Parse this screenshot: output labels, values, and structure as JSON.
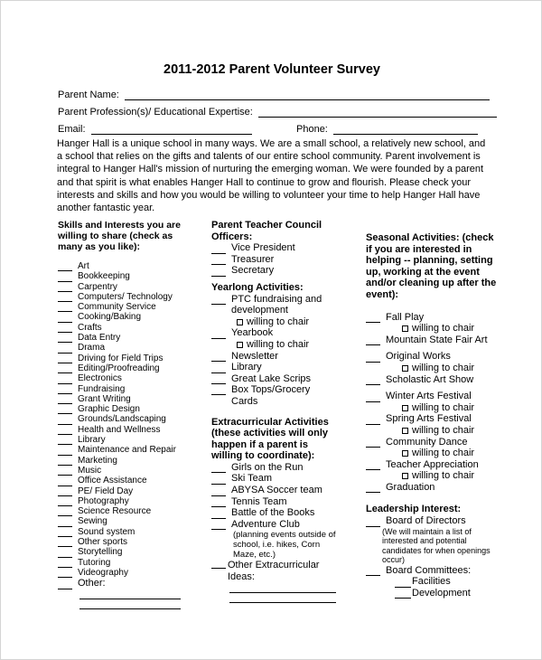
{
  "title": "2011-2012 Parent Volunteer Survey",
  "fields": {
    "parent_name": "Parent Name:",
    "profession": "Parent Profession(s)/ Educational Expertise:",
    "email": "Email:",
    "phone": "Phone:"
  },
  "intro": "Hanger Hall is a unique school in many ways. We are a small school, a relatively new school, and a school  that relies on the gifts and talents of our entire school community.  Parent involvement is integral to Hanger Hall's mission of nurturing the emerging woman.  We were founded by a parent and that spirit is what enables Hanger Hall to continue to grow and flourish.  Please check your interests and skills and how you would be willing to volunteer your time to help Hanger Hall have another fantastic year.",
  "chair_label": "willing to chair",
  "skills": {
    "header": "Skills and Interests you are willing to share (check as many as you like):",
    "items": [
      "Art",
      "Bookkeeping",
      "Carpentry",
      "Computers/ Technology",
      "Community Service",
      "Cooking/Baking",
      "Crafts",
      "Data Entry",
      "Drama",
      "Driving for Field Trips",
      "Editing/Proofreading",
      "Electronics",
      "Fundraising",
      "Grant Writing",
      "Graphic Design",
      "Grounds/Landscaping",
      "Health and Wellness",
      "Library",
      "Maintenance and Repair",
      "Marketing",
      "Music",
      "Office Assistance",
      "PE/ Field Day",
      "Photography",
      "Science Resource",
      "Sewing",
      "Sound system",
      "Other sports",
      "Storytelling",
      "Tutoring",
      "Videography"
    ],
    "other": "Other:"
  },
  "ptc": {
    "header": "Parent Teacher Council Officers:",
    "items": [
      "Vice President",
      "Treasurer",
      "Secretary"
    ]
  },
  "yearlong": {
    "header": "Yearlong Activities:",
    "items": [
      "PTC fundraising and development",
      "Yearbook",
      "Newsletter",
      "Library",
      "Great Lake Scrips",
      "Box Tops/Grocery Cards"
    ]
  },
  "extracurricular": {
    "header": "Extracurricular Activities (these activities will only happen if a parent is willing to coordinate):",
    "items": [
      "Girls on the Run",
      "Ski Team",
      "ABYSA Soccer team",
      "Tennis Team",
      "Battle of the Books",
      "Adventure Club"
    ],
    "adventure_note": "(planning events outside of school, i.e. hikes, Corn Maze, etc.)",
    "other": "Other Extracurricular Ideas:"
  },
  "seasonal": {
    "header": "Seasonal Activities: (check if you are interested in helping -- planning, setting up, working at the event and/or cleaning up after the event):",
    "items": [
      "Fall Play",
      "Mountain State Fair Art",
      "Original Works",
      "Scholastic Art Show",
      "Winter Arts Festival",
      "Spring Arts Festival",
      "Community Dance",
      "Teacher Appreciation",
      "Graduation"
    ]
  },
  "leadership": {
    "header": "Leadership Interest:",
    "board": "Board of Directors",
    "board_note": "(We will maintain a list of interested and potential candidates for when openings occur)",
    "committees": "Board Committees:",
    "committee_items": [
      "Facilities",
      "Development"
    ]
  }
}
